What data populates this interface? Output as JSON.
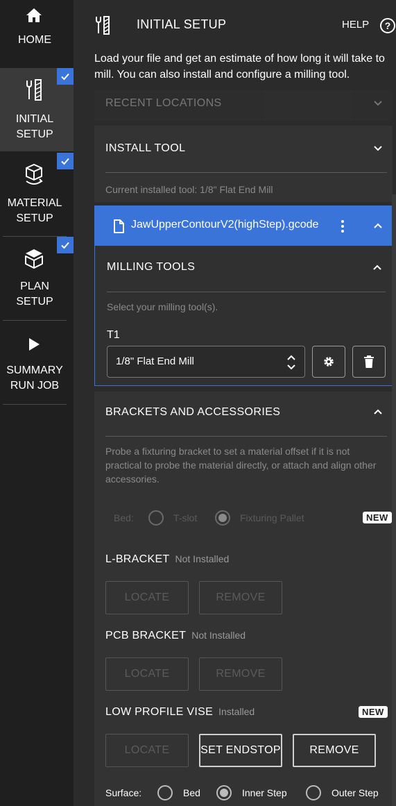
{
  "sidebar": {
    "items": [
      {
        "label": "HOME",
        "icon": "home-icon",
        "checked": false
      },
      {
        "label": "INITIAL\nSETUP",
        "icon": "milling-tool-icon",
        "checked": true,
        "active": true
      },
      {
        "label": "MATERIAL\nSETUP",
        "icon": "cube-rotate-icon",
        "checked": true
      },
      {
        "label": "PLAN\nSETUP",
        "icon": "box-open-icon",
        "checked": true
      },
      {
        "label": "SUMMARY\nRUN JOB",
        "icon": "play-icon",
        "checked": false
      }
    ]
  },
  "header": {
    "title": "INITIAL SETUP",
    "help": "HELP",
    "intro": "Load your file and get an estimate of how long it will take to mill. You can also install and configure a milling tool."
  },
  "recent": {
    "title": "RECENT LOCATIONS"
  },
  "install": {
    "title": "INSTALL TOOL",
    "current_tool": "Current installed tool: 1/8\" Flat End Mill"
  },
  "file": {
    "name": "JawUpperContourV2(highStep).gcode"
  },
  "milling": {
    "title": "MILLING TOOLS",
    "hint": "Select your milling tool(s).",
    "slot": "T1",
    "selected_tool": "1/8\" Flat End Mill"
  },
  "brackets": {
    "title": "BRACKETS AND ACCESSORIES",
    "description": "Probe a fixturing bracket to set a material offset if it is not practical to probe the material directly, or attach and align other accessories.",
    "bed_label": "Bed:",
    "bed_options": [
      "T-slot",
      "Fixturing Pallet"
    ],
    "bed_selected": "Fixturing Pallet",
    "new_badge": "NEW",
    "l_bracket": {
      "name": "L-BRACKET",
      "status": "Not Installed",
      "locate": "LOCATE",
      "remove": "REMOVE"
    },
    "pcb_bracket": {
      "name": "PCB BRACKET",
      "status": "Not Installed",
      "locate": "LOCATE",
      "remove": "REMOVE"
    },
    "vise": {
      "name": "LOW PROFILE VISE",
      "status": "Installed",
      "locate": "LOCATE",
      "endstop": "SET ENDSTOP",
      "remove": "REMOVE"
    },
    "surface_label": "Surface:",
    "surface_options": [
      "Bed",
      "Inner Step",
      "Outer Step"
    ],
    "surface_selected": "Inner Step"
  },
  "colors": {
    "accent": "#3b74d9",
    "sidebar_bg": "#1f1f1f",
    "panel_bg": "#333333"
  }
}
